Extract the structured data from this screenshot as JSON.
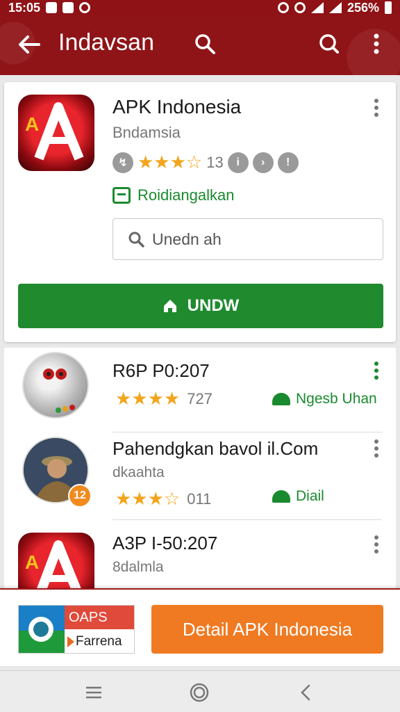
{
  "status_bar": {
    "time": "15:05",
    "battery": "256%"
  },
  "app_bar": {
    "title": "Indavsan"
  },
  "featured": {
    "app_name": "APK Indonesia",
    "developer": "Bndamsia",
    "stars": "★★★☆",
    "rating_count": "13",
    "tag": "Roidiangalkan",
    "search_placeholder": "Unedn ah",
    "download_label": "UNDW"
  },
  "list": [
    {
      "name": "R6P P0:207",
      "subtitle": "",
      "stars": "★★★★",
      "count": "727",
      "status": "Ngesb Uhan"
    },
    {
      "name": "Pahendgkan bavol il.Com",
      "subtitle": "dkaahta",
      "stars": "★★★☆",
      "count": "011",
      "status": "Diail",
      "badge": "12"
    },
    {
      "name": "A3P I-50:207",
      "subtitle": "8dalmla"
    }
  ],
  "bottom": {
    "ad_top": "OAPS",
    "ad_bottom": "Farrena",
    "detail_label": "Detail APK Indonesia"
  },
  "colors": {
    "brand": "#8f1418",
    "green": "#1f8a2e",
    "orange": "#ef7a22",
    "star": "#f2a51d"
  }
}
